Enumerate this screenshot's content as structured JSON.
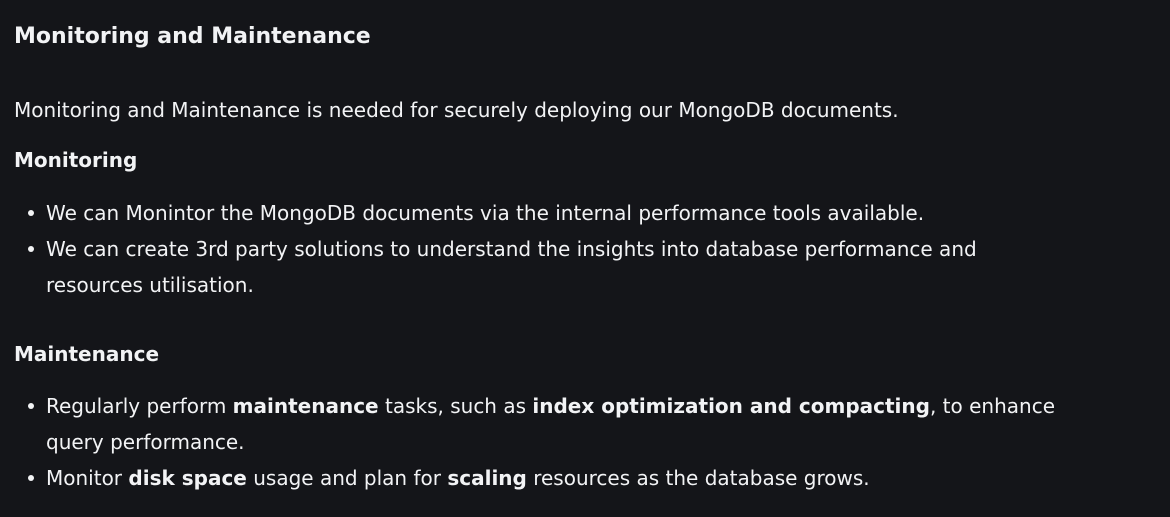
{
  "section": {
    "title": "Monitoring and Maintenance",
    "intro": "Monitoring and Maintenance is needed for securely deploying our MongoDB documents."
  },
  "monitoring": {
    "heading": "Monitoring",
    "items": [
      {
        "text": "We can Monintor the MongoDB documents via the internal performance tools available."
      },
      {
        "text": "We can create 3rd party solutions to understand the insights into database performance and resources utilisation."
      }
    ]
  },
  "maintenance": {
    "heading": "Maintenance",
    "items": [
      {
        "p1": "Regularly perform ",
        "b1": "maintenance",
        "p2": " tasks, such as ",
        "b2": "index optimization and compacting",
        "p3": ", to enhance query performance."
      },
      {
        "p1": "Monitor ",
        "b1": "disk space",
        "p2": " usage and plan for ",
        "b2": "scaling",
        "p3": " resources as the database grows."
      }
    ]
  }
}
